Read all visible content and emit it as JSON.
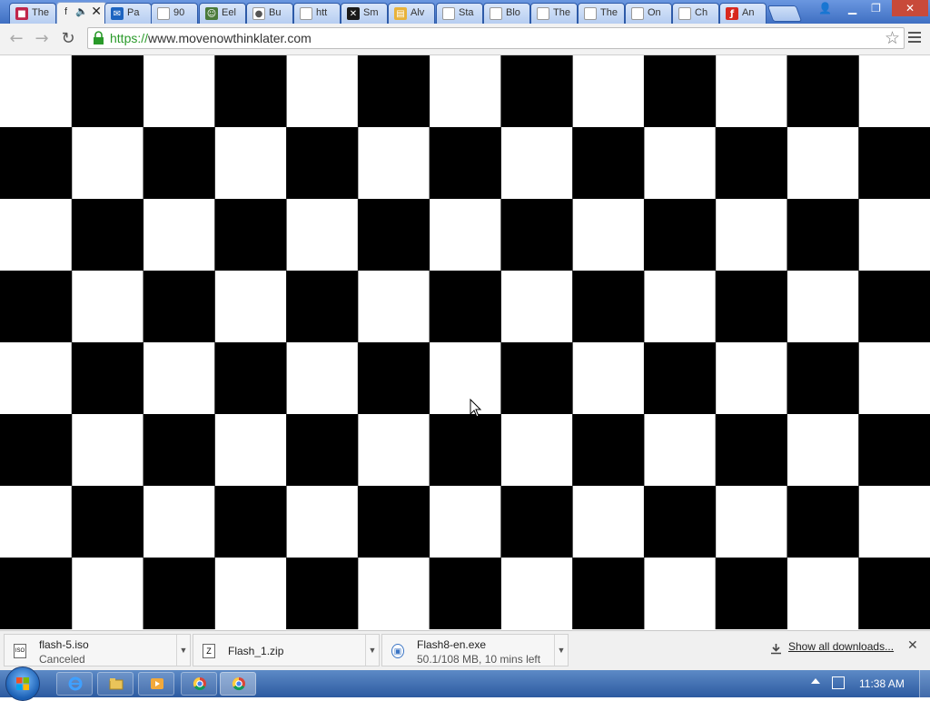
{
  "tabs": [
    {
      "title": "The",
      "fav_color": "#c0264b",
      "fav_glyph": "■"
    },
    {
      "title": "f",
      "fav_color": "#f2f2f2",
      "fav_glyph": "",
      "active": true,
      "audio": true
    },
    {
      "title": "Pa",
      "fav_color": "#1d64c0",
      "fav_glyph": "✉"
    },
    {
      "title": "90",
      "fav_color": "#ffffff",
      "fav_glyph": ""
    },
    {
      "title": "Eel",
      "fav_color": "#4a7a3a",
      "fav_glyph": "☺"
    },
    {
      "title": "Bu",
      "fav_color": "#ffffff",
      "fav_glyph": "●"
    },
    {
      "title": "htt",
      "fav_color": "#ffffff",
      "fav_glyph": ""
    },
    {
      "title": "Sm",
      "fav_color": "#1a1a1a",
      "fav_glyph": "✕"
    },
    {
      "title": "Alv",
      "fav_color": "#e8b23a",
      "fav_glyph": "▤"
    },
    {
      "title": "Sta",
      "fav_color": "#ffffff",
      "fav_glyph": ""
    },
    {
      "title": "Blo",
      "fav_color": "#ffffff",
      "fav_glyph": ""
    },
    {
      "title": "The",
      "fav_color": "#ffffff",
      "fav_glyph": ""
    },
    {
      "title": "The",
      "fav_color": "#ffffff",
      "fav_glyph": ""
    },
    {
      "title": "On",
      "fav_color": "#ffffff",
      "fav_glyph": ""
    },
    {
      "title": "Ch",
      "fav_color": "#ffffff",
      "fav_glyph": ""
    },
    {
      "title": "An",
      "fav_color": "#d8281e",
      "fav_glyph": "ƒ"
    }
  ],
  "active_tab_close": "✕",
  "window_controls": {
    "user": "👤",
    "minimize": "▁",
    "restore": "❐",
    "close": "✕"
  },
  "toolbar": {
    "back": "←",
    "forward": "→",
    "reload": "↻",
    "url_scheme": "https://",
    "url_host": "www.movenowthinklater.com",
    "star": "☆"
  },
  "board": {
    "rows": 8,
    "cols": 13,
    "dark": "#000000",
    "light": "#ffffff"
  },
  "downloads": [
    {
      "name": "flash-5.iso",
      "status": "Canceled",
      "icon": "ISO"
    },
    {
      "name": "Flash_1.zip",
      "status": "",
      "icon": "Z"
    },
    {
      "name": "Flash8-en.exe",
      "status": "50.1/108 MB, 10 mins left",
      "icon": "▣"
    }
  ],
  "show_all_downloads": "Show all downloads...",
  "shelf_close": "✕",
  "taskbar": {
    "apps": [
      "ie",
      "explorer",
      "media",
      "chrome",
      "chrome"
    ],
    "clock": "11:38 AM"
  }
}
